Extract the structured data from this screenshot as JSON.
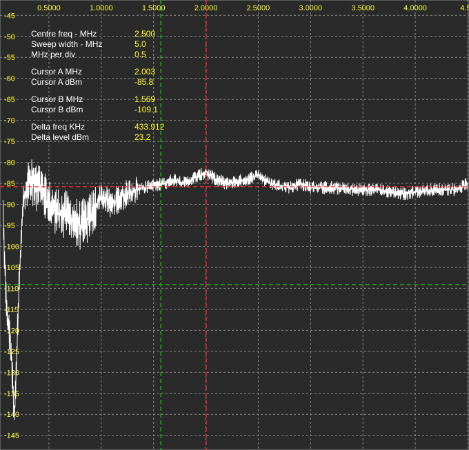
{
  "info_panel": {
    "centre_freq_label": "Centre freq - MHz",
    "centre_freq_value": "2.500",
    "sweep_width_label": "Sweep width - MHz",
    "sweep_width_value": "5.0",
    "mhz_per_div_label": "MHz per div",
    "mhz_per_div_value": "0.5",
    "cursor_a_mhz_label": "Cursor A MHz",
    "cursor_a_mhz_value": "2.003",
    "cursor_a_dbm_label": "Cursor A dBm",
    "cursor_a_dbm_value": "-85.8",
    "cursor_b_mhz_label": "Cursor B MHz",
    "cursor_b_mhz_value": "1.569",
    "cursor_b_dbm_label": "Cursor B dBm",
    "cursor_b_dbm_value": "-109.1",
    "delta_freq_label": "Delta freq KHz",
    "delta_freq_value": "433.912",
    "delta_level_label": "Delta level dBm",
    "delta_level_value": "23.2"
  },
  "colors": {
    "background": "#2a2a2a",
    "grid": "#8a8a8a",
    "trace": "#ffffff",
    "tick_label": "#ffff33",
    "cursor_a": "#ff2a2a",
    "cursor_b": "#22bb22"
  },
  "chart_data": {
    "type": "line",
    "title": "",
    "xlabel": "",
    "ylabel": "",
    "xlim": [
      0.059,
      4.5
    ],
    "ylim": [
      -148,
      -42
    ],
    "x_ticks": [
      "0.5000",
      "1.0000",
      "1.5000",
      "2.0000",
      "2.5000",
      "3.0000",
      "3.5000",
      "4.0000",
      "4.50"
    ],
    "x_tick_values": [
      0.5,
      1.0,
      1.5,
      2.0,
      2.5,
      3.0,
      3.5,
      4.0,
      4.5
    ],
    "y_ticks": [
      "-45",
      "-50",
      "-55",
      "-60",
      "-65",
      "-70",
      "-75",
      "-80",
      "-85",
      "-90",
      "-95",
      "-100",
      "-105",
      "-110",
      "-115",
      "-120",
      "-125",
      "-130",
      "-135",
      "-140",
      "-145"
    ],
    "y_tick_values": [
      -45,
      -50,
      -55,
      -60,
      -65,
      -70,
      -75,
      -80,
      -85,
      -90,
      -95,
      -100,
      -105,
      -110,
      -115,
      -120,
      -125,
      -130,
      -135,
      -140,
      -145
    ],
    "grid": true,
    "cursors": [
      {
        "name": "A",
        "freq_mhz": 2.003,
        "level_dbm": -85.8
      },
      {
        "name": "B",
        "freq_mhz": 1.569,
        "level_dbm": -109.1
      }
    ],
    "series": [
      {
        "x": [
          0.06,
          0.07,
          0.09,
          0.11,
          0.14,
          0.17,
          0.2,
          0.22,
          0.24,
          0.26,
          0.3,
          0.35,
          0.4,
          0.45,
          0.5,
          0.6,
          0.7,
          0.8,
          0.9,
          1.0,
          1.1,
          1.2,
          1.3,
          1.4,
          1.5,
          1.6,
          1.7,
          1.8,
          1.9,
          2.0,
          2.1,
          2.2,
          2.3,
          2.4,
          2.5,
          2.6,
          2.7,
          2.8,
          2.9,
          3.0,
          3.2,
          3.4,
          3.6,
          3.8,
          3.9,
          4.0,
          4.2,
          4.4,
          4.5
        ],
        "y": [
          -86,
          -100,
          -112,
          -118,
          -125,
          -141,
          -120,
          -105,
          -95,
          -88,
          -85,
          -85,
          -86,
          -88,
          -90,
          -92,
          -93,
          -95,
          -93,
          -88,
          -90,
          -88,
          -87,
          -86,
          -85.5,
          -85,
          -84,
          -85,
          -83.5,
          -82.5,
          -84,
          -85,
          -84.5,
          -84,
          -83,
          -85,
          -85.5,
          -86,
          -85,
          -86,
          -86,
          -86.5,
          -86.5,
          -87,
          -87.5,
          -87,
          -86.5,
          -86.5,
          -85
        ]
      }
    ]
  }
}
